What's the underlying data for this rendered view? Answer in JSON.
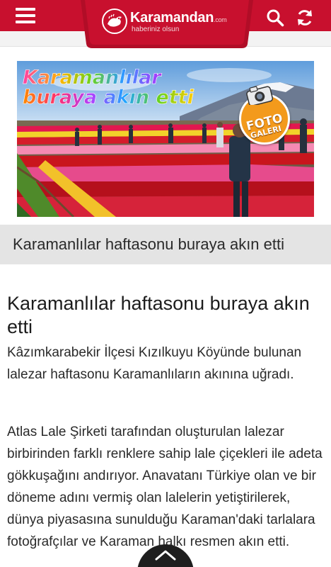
{
  "header": {
    "brand": "Karamandan",
    "brand_suffix": ".com",
    "slogan": "haberiniz olsun",
    "colors": {
      "bar": "#c8102e",
      "tab": "#b10d27"
    },
    "icons": {
      "menu": "hamburger-icon",
      "search": "search-icon",
      "refresh": "refresh-icon"
    }
  },
  "hero": {
    "overlay_line1": "Karamanlılar",
    "overlay_line2": "buraya akın etti",
    "badge_line1": "FOTO",
    "badge_line2": "GALERI"
  },
  "caption": "Karamanlılar haftasonu buraya akın etti",
  "article": {
    "title": "Karamanlılar haftasonu buraya akın etti",
    "lead": "Kâzımkarabekir İlçesi Kızılkuyu Köyünde bulunan lalezar haftasonu Karamanlıların akınına uğradı.",
    "body": "Atlas Lale Şirketi tarafından oluşturulan lalezar birbirinden farklı renklere sahip lale çiçekleri ile adeta gökkuşağını andırıyor. Anavatanı Türkiye olan ve bir döneme adını vermiş olan lalelerin yetiştirilerek, dünya piyasasına sunulduğu Karaman'daki tarlalara fotoğrafçılar ve Karaman halkı resmen akın etti."
  },
  "scroll_top": {
    "icon": "chevron-up-icon"
  }
}
